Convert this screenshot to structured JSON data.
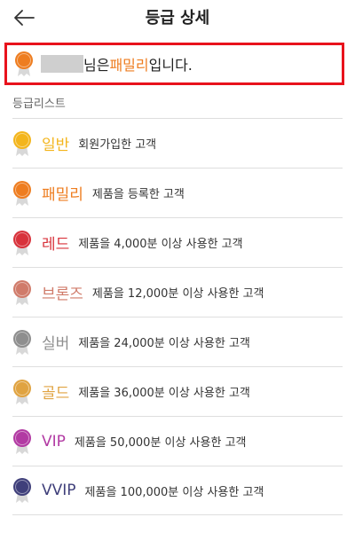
{
  "header": {
    "title": "등급 상세",
    "back_icon": "back-arrow-icon"
  },
  "current": {
    "suffix_before": "님은 ",
    "grade": "패밀리",
    "suffix_after": "입니다.",
    "grade_color": "#ee7d20",
    "highlight_color": "#e8121c"
  },
  "list_label": "등급리스트",
  "grades": [
    {
      "name": "일반",
      "desc": "회원가입한 고객",
      "color": "#f3b51c",
      "icon": "medal-icon"
    },
    {
      "name": "패밀리",
      "desc": "제품을 등록한 고객",
      "color": "#ee7d20",
      "icon": "medal-icon"
    },
    {
      "name": "레드",
      "desc": "제품을 4,000분 이상 사용한 고객",
      "color": "#d8323b",
      "icon": "medal-icon"
    },
    {
      "name": "브론즈",
      "desc": "제품을 12,000분 이상 사용한 고객",
      "color": "#d07b6a",
      "icon": "medal-icon"
    },
    {
      "name": "실버",
      "desc": "제품을 24,000분 이상 사용한 고객",
      "color": "#8e8e8e",
      "icon": "medal-icon"
    },
    {
      "name": "골드",
      "desc": "제품을 36,000분 이상 사용한 고객",
      "color": "#e0a341",
      "icon": "medal-icon"
    },
    {
      "name": "VIP",
      "desc": "제품을 50,000분 이상 사용한 고객",
      "color": "#b23aa3",
      "icon": "medal-icon"
    },
    {
      "name": "VVIP",
      "desc": "제품을 100,000분 이상 사용한 고객",
      "color": "#3f3f7a",
      "icon": "medal-icon"
    }
  ]
}
